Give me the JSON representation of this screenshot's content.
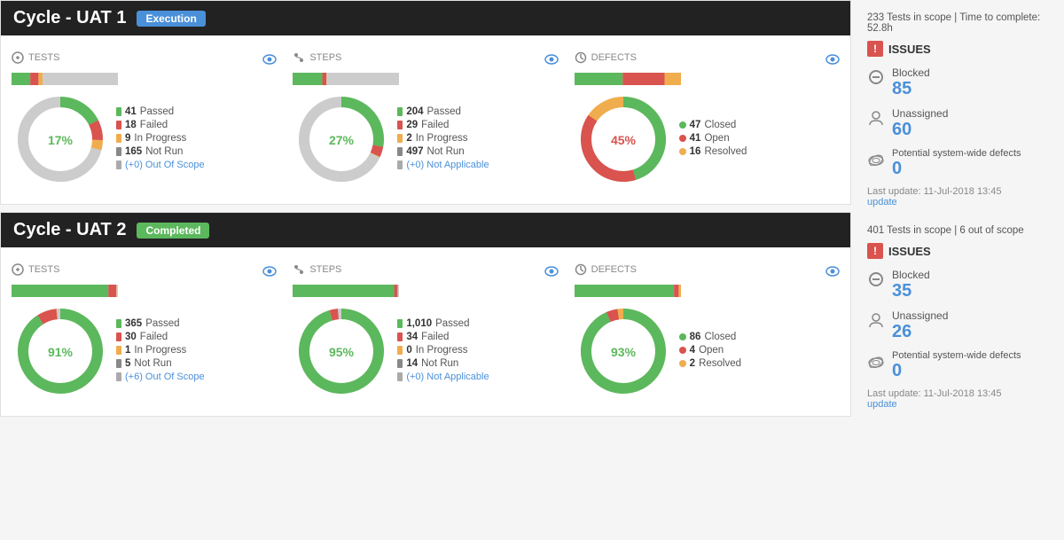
{
  "cycles": [
    {
      "id": "uat1",
      "title": "Cycle - UAT 1",
      "badge": "Execution",
      "badge_class": "badge-execution",
      "scope_bar": "233 Tests in scope | Time to complete: 52.8h",
      "tests": {
        "title": "TESTS",
        "percentage": "17%",
        "color": "#5cb85c",
        "segments": [
          {
            "value": 41,
            "color": "#5cb85c",
            "angle": 57
          },
          {
            "value": 18,
            "color": "#d9534f",
            "angle": 25
          },
          {
            "value": 9,
            "color": "#f0ad4e",
            "angle": 12
          },
          {
            "value": 165,
            "color": "#ccc",
            "angle": 230
          }
        ],
        "legend": [
          {
            "count": "41",
            "label": "Passed",
            "color": "#5cb85c",
            "type": "bar"
          },
          {
            "count": "18",
            "label": "Failed",
            "color": "#d9534f",
            "type": "bar"
          },
          {
            "count": "9",
            "label": "In Progress",
            "color": "#f0ad4e",
            "type": "bar"
          },
          {
            "count": "165",
            "label": "Not Run",
            "color": "#888",
            "type": "bar"
          },
          {
            "count": "(+0)",
            "label": "Out Of Scope",
            "color": "#aaa",
            "type": "link",
            "is_link": true
          }
        ]
      },
      "steps": {
        "title": "STEPS",
        "percentage": "27%",
        "color": "#5cb85c",
        "segments": [
          {
            "value": 204,
            "color": "#5cb85c",
            "angle": 97
          },
          {
            "value": 29,
            "color": "#d9534f",
            "angle": 14
          },
          {
            "value": 2,
            "color": "#f0ad4e",
            "angle": 1
          },
          {
            "value": 497,
            "color": "#ccc",
            "angle": 237
          }
        ],
        "legend": [
          {
            "count": "204",
            "label": "Passed",
            "color": "#5cb85c",
            "type": "bar"
          },
          {
            "count": "29",
            "label": "Failed",
            "color": "#d9534f",
            "type": "bar"
          },
          {
            "count": "2",
            "label": "In Progress",
            "color": "#f0ad4e",
            "type": "bar"
          },
          {
            "count": "497",
            "label": "Not Run",
            "color": "#888",
            "type": "bar"
          },
          {
            "count": "(+0)",
            "label": "Not Applicable",
            "color": "#aaa",
            "type": "link",
            "is_link": true
          }
        ]
      },
      "defects": {
        "title": "DEFECTS",
        "percentage": "45%",
        "color": "#d9534f",
        "segments": [
          {
            "value": 47,
            "color": "#5cb85c",
            "angle": 165
          },
          {
            "value": 41,
            "color": "#d9534f",
            "angle": 143
          },
          {
            "value": 16,
            "color": "#f0ad4e",
            "angle": 56
          }
        ],
        "legend": [
          {
            "count": "47",
            "label": "Closed",
            "color": "#5cb85c",
            "type": "dot"
          },
          {
            "count": "41",
            "label": "Open",
            "color": "#d9534f",
            "type": "dot"
          },
          {
            "count": "16",
            "label": "Resolved",
            "color": "#f0ad4e",
            "type": "dot"
          }
        ]
      },
      "issues": {
        "blocked": "85",
        "unassigned": "60",
        "potential": "0",
        "last_update": "Last update: 11-Jul-2018 13:45"
      }
    },
    {
      "id": "uat2",
      "title": "Cycle - UAT 2",
      "badge": "Completed",
      "badge_class": "badge-completed",
      "scope_bar": "401 Tests in scope | 6 out of scope",
      "tests": {
        "title": "TESTS",
        "percentage": "91%",
        "color": "#5cb85c",
        "segments": [
          {
            "value": 365,
            "color": "#5cb85c",
            "angle": 328
          },
          {
            "value": 30,
            "color": "#d9534f",
            "angle": 27
          },
          {
            "value": 1,
            "color": "#f0ad4e",
            "angle": 1
          },
          {
            "value": 5,
            "color": "#ccc",
            "angle": 4
          }
        ],
        "legend": [
          {
            "count": "365",
            "label": "Passed",
            "color": "#5cb85c",
            "type": "bar"
          },
          {
            "count": "30",
            "label": "Failed",
            "color": "#d9534f",
            "type": "bar"
          },
          {
            "count": "1",
            "label": "In Progress",
            "color": "#f0ad4e",
            "type": "bar"
          },
          {
            "count": "5",
            "label": "Not Run",
            "color": "#888",
            "type": "bar"
          },
          {
            "count": "(+6)",
            "label": "Out Of Scope",
            "color": "#aaa",
            "type": "link",
            "is_link": true
          }
        ]
      },
      "steps": {
        "title": "STEPS",
        "percentage": "95%",
        "color": "#5cb85c",
        "segments": [
          {
            "value": 1010,
            "color": "#5cb85c",
            "angle": 342
          },
          {
            "value": 34,
            "color": "#d9534f",
            "angle": 12
          },
          {
            "value": 0,
            "color": "#f0ad4e",
            "angle": 0
          },
          {
            "value": 14,
            "color": "#ccc",
            "angle": 5
          }
        ],
        "legend": [
          {
            "count": "1,010",
            "label": "Passed",
            "color": "#5cb85c",
            "type": "bar"
          },
          {
            "count": "34",
            "label": "Failed",
            "color": "#d9534f",
            "type": "bar"
          },
          {
            "count": "0",
            "label": "In Progress",
            "color": "#f0ad4e",
            "type": "bar"
          },
          {
            "count": "14",
            "label": "Not Run",
            "color": "#888",
            "type": "bar"
          },
          {
            "count": "(+0)",
            "label": "Not Applicable",
            "color": "#aaa",
            "type": "link",
            "is_link": true
          }
        ]
      },
      "defects": {
        "title": "DEFECTS",
        "percentage": "93%",
        "color": "#5cb85c",
        "segments": [
          {
            "value": 86,
            "color": "#5cb85c",
            "angle": 335
          },
          {
            "value": 4,
            "color": "#d9534f",
            "angle": 16
          },
          {
            "value": 2,
            "color": "#f0ad4e",
            "angle": 8
          }
        ],
        "legend": [
          {
            "count": "86",
            "label": "Closed",
            "color": "#5cb85c",
            "type": "dot"
          },
          {
            "count": "4",
            "label": "Open",
            "color": "#d9534f",
            "type": "dot"
          },
          {
            "count": "2",
            "label": "Resolved",
            "color": "#f0ad4e",
            "type": "dot"
          }
        ]
      },
      "issues": {
        "blocked": "35",
        "unassigned": "26",
        "potential": "0",
        "last_update": "Last update: 11-Jul-2018 13:45"
      }
    }
  ],
  "labels": {
    "tests": "TESTS",
    "steps": "STEPS",
    "defects": "DEFECTS",
    "issues": "ISSUES",
    "blocked": "Blocked",
    "unassigned": "Unassigned",
    "potential": "Potential system-wide defects",
    "update": "update"
  }
}
